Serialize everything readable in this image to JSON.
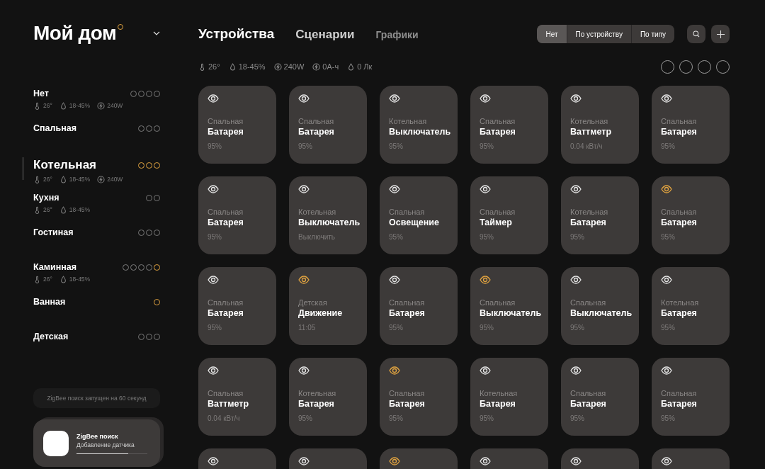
{
  "sidebar": {
    "title": "Мой дом",
    "rooms": [
      {
        "name": "Нет",
        "selected": false,
        "dots": [
          {
            "on": false
          },
          {
            "on": false
          },
          {
            "on": false
          },
          {
            "on": false
          }
        ],
        "stats": [
          {
            "kind": "temp",
            "text": "26°"
          },
          {
            "kind": "humidity",
            "text": "18-45%"
          },
          {
            "kind": "power",
            "text": "240W"
          }
        ]
      },
      {
        "name": "Спальная",
        "selected": false,
        "dots": [
          {
            "on": false
          },
          {
            "on": false
          },
          {
            "on": false
          }
        ]
      },
      {
        "name": "Котельная",
        "selected": true,
        "dots": [
          {
            "on": true
          },
          {
            "on": true
          },
          {
            "on": true
          }
        ],
        "stats": [
          {
            "kind": "temp",
            "text": "26°"
          },
          {
            "kind": "humidity",
            "text": "18-45%"
          },
          {
            "kind": "power",
            "text": "240W"
          }
        ]
      },
      {
        "name": "Кухня",
        "selected": false,
        "dots": [
          {
            "on": false
          },
          {
            "on": false
          }
        ],
        "stats": [
          {
            "kind": "temp",
            "text": "26°"
          },
          {
            "kind": "humidity",
            "text": "18-45%"
          }
        ]
      },
      {
        "name": "Гостиная",
        "selected": false,
        "dots": [
          {
            "on": false
          },
          {
            "on": false
          },
          {
            "on": false
          }
        ]
      },
      {
        "name": "Каминная",
        "selected": false,
        "dots": [
          {
            "on": false
          },
          {
            "on": false
          },
          {
            "on": false
          },
          {
            "on": false
          },
          {
            "on": true
          }
        ],
        "stats": [
          {
            "kind": "temp",
            "text": "26°"
          },
          {
            "kind": "humidity",
            "text": "18-45%"
          }
        ]
      },
      {
        "name": "Ванная",
        "selected": false,
        "dots": [
          {
            "on": true
          }
        ]
      },
      {
        "name": "Детская",
        "selected": false,
        "dots": [
          {
            "on": false
          },
          {
            "on": false
          },
          {
            "on": false
          }
        ]
      }
    ],
    "toast": "ZigBee поиск запущен на 60 секунд",
    "zigbee_card": {
      "title": "ZigBee поиск",
      "subtitle": "Добавление датчика",
      "level": 0.73
    }
  },
  "tabs": [
    {
      "label": "Устройства",
      "selected": true
    },
    {
      "label": "Сценарии",
      "selected": false
    },
    {
      "label": "Графики",
      "selected": false
    }
  ],
  "filter": [
    {
      "label": "Нет",
      "selected": true
    },
    {
      "label": "По устройству",
      "selected": false
    },
    {
      "label": "По типу",
      "selected": false
    }
  ],
  "stats": [
    {
      "kind": "temp",
      "text": "26°"
    },
    {
      "kind": "humidity",
      "text": "18-45%"
    },
    {
      "kind": "power",
      "text": "240W"
    },
    {
      "kind": "power",
      "text": "0А-ч"
    },
    {
      "kind": "humidity",
      "text": "0 Лк"
    }
  ],
  "devices": [
    {
      "alert": false,
      "room": "Спальная",
      "name": "Батарея",
      "value": "95%"
    },
    {
      "alert": false,
      "room": "Спальная",
      "name": "Батарея",
      "value": "95%"
    },
    {
      "alert": false,
      "room": "Котельная",
      "name": "Выключатель",
      "value": "95%"
    },
    {
      "alert": false,
      "room": "Спальная",
      "name": "Батарея",
      "value": "95%"
    },
    {
      "alert": false,
      "room": "Котельная",
      "name": "Ваттметр",
      "value": "0.04 кВт/ч"
    },
    {
      "alert": false,
      "room": "Спальная",
      "name": "Батарея",
      "value": "95%"
    },
    {
      "alert": false,
      "room": "Спальная",
      "name": "Батарея",
      "value": "95%"
    },
    {
      "alert": false,
      "room": "Котельная",
      "name": "Выключатель",
      "value": "Выключить"
    },
    {
      "alert": false,
      "room": "Спальная",
      "name": "Освещение",
      "value": "95%"
    },
    {
      "alert": false,
      "room": "Спальная",
      "name": "Таймер",
      "value": "95%"
    },
    {
      "alert": false,
      "room": "Котельная",
      "name": "Батарея",
      "value": "95%"
    },
    {
      "alert": true,
      "room": "Спальная",
      "name": "Батарея",
      "value": "95%"
    },
    {
      "alert": false,
      "room": "Спальная",
      "name": "Батарея",
      "value": "95%"
    },
    {
      "alert": true,
      "room": "Детская",
      "name": "Движение",
      "value": "11:05"
    },
    {
      "alert": false,
      "room": "Спальная",
      "name": "Батарея",
      "value": "95%"
    },
    {
      "alert": true,
      "room": "Спальная",
      "name": "Выключатель",
      "value": "95%"
    },
    {
      "alert": false,
      "room": "Спальная",
      "name": "Выключатель",
      "value": "95%"
    },
    {
      "alert": false,
      "room": "Котельная",
      "name": "Батарея",
      "value": "95%"
    },
    {
      "alert": false,
      "room": "Спальная",
      "name": "Ваттметр",
      "value": "0.04 кВт/ч"
    },
    {
      "alert": false,
      "room": "Котельная",
      "name": "Батарея",
      "value": "95%"
    },
    {
      "alert": true,
      "room": "Спальная",
      "name": "Батарея",
      "value": "95%"
    },
    {
      "alert": false,
      "room": "Котельная",
      "name": "Батарея",
      "value": "95%"
    },
    {
      "alert": false,
      "room": "Спальная",
      "name": "Батарея",
      "value": "95%"
    },
    {
      "alert": false,
      "room": "Спальная",
      "name": "Батарея",
      "value": "95%"
    },
    {
      "alert": false
    },
    {
      "alert": false
    },
    {
      "alert": true
    },
    {
      "alert": false
    },
    {
      "alert": false
    },
    {
      "alert": false
    }
  ]
}
